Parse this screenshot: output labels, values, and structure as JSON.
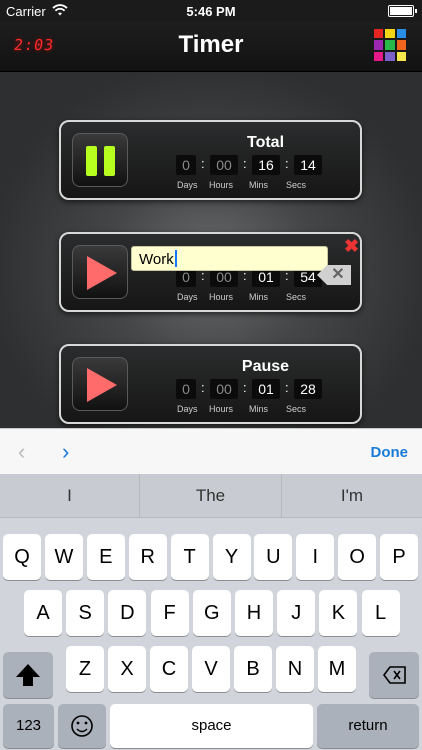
{
  "status_bar": {
    "carrier": "Carrier",
    "time": "5:46 PM"
  },
  "nav": {
    "title": "Timer",
    "clock_icon_text": "2:03",
    "grid_icon_colors": [
      "#e52620",
      "#f2d616",
      "#2a8ee8",
      "#9c27b0",
      "#29b84a",
      "#f0641e",
      "#e5198a",
      "#7b61c9",
      "#f6e84a"
    ]
  },
  "timers": [
    {
      "name": "Total",
      "state": "paused",
      "days": "0",
      "hours": "00",
      "mins": "16",
      "secs": "14"
    },
    {
      "name": "Work",
      "state": "editing",
      "days": "0",
      "hours": "00",
      "mins": "01",
      "secs": "54"
    },
    {
      "name": "Pause",
      "state": "stopped",
      "days": "0",
      "hours": "00",
      "mins": "01",
      "secs": "28"
    }
  ],
  "units": {
    "days": "Days",
    "hours": "Hours",
    "mins": "Mins",
    "secs": "Secs"
  },
  "accessory": {
    "done": "Done",
    "prev_icon": "chevron-left-icon",
    "next_icon": "chevron-right-icon"
  },
  "keyboard": {
    "suggestions": [
      "I",
      "The",
      "I'm"
    ],
    "row1": [
      "Q",
      "W",
      "E",
      "R",
      "T",
      "Y",
      "U",
      "I",
      "O",
      "P"
    ],
    "row2": [
      "A",
      "S",
      "D",
      "F",
      "G",
      "H",
      "J",
      "K",
      "L"
    ],
    "row3": [
      "Z",
      "X",
      "C",
      "V",
      "B",
      "N",
      "M"
    ],
    "numbers": "123",
    "space": "space",
    "return": "return"
  },
  "colors": {
    "accent": "#1a7bd6",
    "play_red": "#ff6b6b",
    "pause_green": "#b7ff1e",
    "input_bg": "#ffffcf"
  }
}
